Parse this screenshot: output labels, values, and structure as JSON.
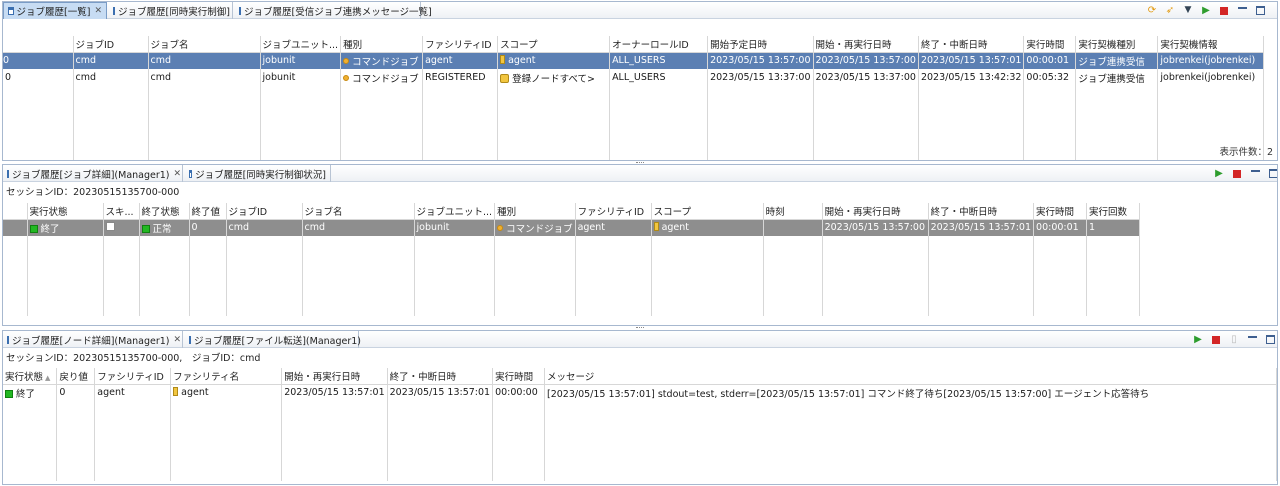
{
  "panel1": {
    "tabs": [
      {
        "label": "ジョブ履歴[一覧]",
        "active": true,
        "closable": true
      },
      {
        "label": "ジョブ履歴[同時実行制御]",
        "active": false,
        "closable": false
      },
      {
        "label": "ジョブ履歴[受信ジョブ連携メッセージ一覧]",
        "active": false,
        "closable": false
      }
    ],
    "columns": [
      "",
      "ジョブID",
      "ジョブ名",
      "ジョブユニット...",
      "種別",
      "ファシリティID",
      "スコープ",
      "オーナーロールID",
      "開始予定日時",
      "開始・再実行日時",
      "終了・中断日時",
      "実行時間",
      "実行契機種別",
      "実行契機情報"
    ],
    "rows": [
      {
        "c0": "0",
        "job_id": "cmd",
        "job_name": "cmd",
        "jobunit": "jobunit",
        "type": "コマンドジョブ",
        "facility": "agent",
        "scope": "agent",
        "owner": "ALL_USERS",
        "scheduled": "2023/05/15 13:57:00",
        "start": "2023/05/15 13:57:00",
        "end": "2023/05/15 13:57:01",
        "duration": "00:00:01",
        "trigger_type": "ジョブ連携受信",
        "trigger_info": "jobrenkei(jobrenkei)"
      },
      {
        "c0": "0",
        "job_id": "cmd",
        "job_name": "cmd",
        "jobunit": "jobunit",
        "type": "コマンドジョブ",
        "facility": "REGISTERED",
        "scope": "登録ノードすべて>",
        "owner": "ALL_USERS",
        "scheduled": "2023/05/15 13:37:00",
        "start": "2023/05/15 13:37:00",
        "end": "2023/05/15 13:42:32",
        "duration": "00:05:32",
        "trigger_type": "ジョブ連携受信",
        "trigger_info": "jobrenkei(jobrenkei)"
      }
    ],
    "count_label": "表示件数：2"
  },
  "panel2": {
    "tabs": [
      {
        "label": "ジョブ履歴[ジョブ詳細](Manager1)",
        "active": false,
        "closable": true
      },
      {
        "label": "ジョブ履歴[同時実行制御状況]",
        "active": false,
        "closable": false
      }
    ],
    "session_info": "セッションID：20230515135700-000",
    "columns": [
      "実行状態",
      "スキ...",
      "終了状態",
      "終了値",
      "ジョブID",
      "ジョブ名",
      "ジョブユニット...",
      "種別",
      "ファシリティID",
      "スコープ",
      "時刻",
      "開始・再実行日時",
      "終了・中断日時",
      "実行時間",
      "実行回数"
    ],
    "rows": [
      {
        "status": "終了",
        "end_status": "正常",
        "end_value": "0",
        "job_id": "cmd",
        "job_name": "cmd",
        "jobunit": "jobunit",
        "type": "コマンドジョブ",
        "facility": "agent",
        "scope": "agent",
        "time": "",
        "start": "2023/05/15 13:57:00",
        "end": "2023/05/15 13:57:01",
        "duration": "00:00:01",
        "run_count": "1"
      }
    ]
  },
  "panel3": {
    "tabs": [
      {
        "label": "ジョブ履歴[ノード詳細](Manager1)",
        "active": false,
        "closable": true
      },
      {
        "label": "ジョブ履歴[ファイル転送](Manager1)",
        "active": false,
        "closable": false
      }
    ],
    "session_info": "セッションID：20230515135700-000,　ジョブID：cmd",
    "columns": [
      "実行状態",
      "戻り値",
      "ファシリティID",
      "ファシリティ名",
      "開始・再実行日時",
      "終了・中断日時",
      "実行時間",
      "メッセージ"
    ],
    "rows": [
      {
        "status": "終了",
        "return_value": "0",
        "facility_id": "agent",
        "facility_name": "agent",
        "start": "2023/05/15 13:57:01",
        "end": "2023/05/15 13:57:01",
        "duration": "00:00:00",
        "message": "[2023/05/15 13:57:01] stdout=test, stderr=[2023/05/15 13:57:01] コマンド終了待ち[2023/05/15 13:57:00] エージェント応答待ち"
      }
    ]
  },
  "colors": {
    "selected_row": "#5b7fb3",
    "selected_row_gray": "#8e8e8e",
    "status_ok": "#22b822",
    "stop": "#d32626",
    "run": "#2e9d2e"
  },
  "icons": [
    "tab-view-icon",
    "close-icon",
    "refresh-icon",
    "rocket-icon",
    "filter-icon",
    "run-icon",
    "stop-icon",
    "minimize-icon",
    "maximize-icon",
    "job-type-dot-icon",
    "node-icon",
    "node-group-icon",
    "status-green-icon",
    "checkbox-icon",
    "sort-ascending-icon"
  ]
}
